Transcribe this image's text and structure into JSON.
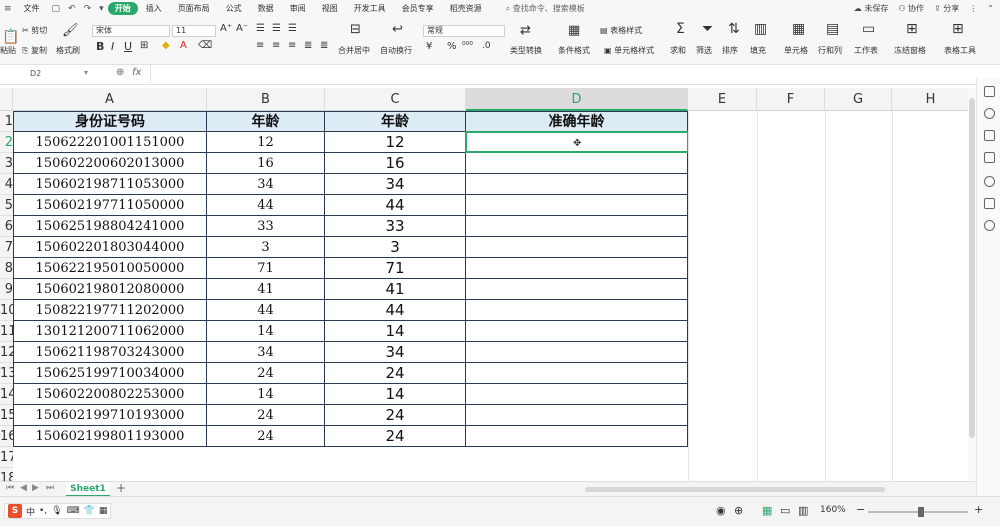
{
  "tabbar": {
    "file": "文件",
    "tabs": [
      "开始",
      "插入",
      "页面布局",
      "公式",
      "数据",
      "审阅",
      "视图",
      "开发工具",
      "会员专享",
      "稻壳资源"
    ],
    "active_tab": "开始",
    "search": "查找命令、搜索模板",
    "unsaved": "未保存",
    "collab": "协作",
    "share": "分享"
  },
  "ribbon": {
    "cut": "剪切",
    "paste": "粘贴",
    "copy": "复制",
    "format_painter": "格式刷",
    "font_name": "宋体",
    "font_size": "11",
    "bold": "B",
    "italic": "I",
    "underline": "U",
    "merge_center": "合并居中",
    "wrap_text": "自动换行",
    "number_format": "常规",
    "yen": "¥",
    "percent": "%",
    "type_convert": "类型转换",
    "cond_format": "条件格式",
    "table_style": "表格样式",
    "cell_style": "单元格样式",
    "sum": "求和",
    "filter": "筛选",
    "sort": "排序",
    "fill": "填充",
    "cell": "单元格",
    "rows_cols": "行和列",
    "worksheet": "工作表",
    "freeze": "冻结窗格",
    "table_tools": "表格工具"
  },
  "formula_bar": {
    "name_box": "D2",
    "fx": "fx"
  },
  "columns": [
    "A",
    "B",
    "C",
    "D",
    "E",
    "F",
    "G",
    "H"
  ],
  "selected_column": "D",
  "row_numbers": [
    "1",
    "2",
    "3",
    "4",
    "5",
    "6",
    "7",
    "8",
    "9",
    "10",
    "11",
    "12",
    "13",
    "14",
    "15",
    "16",
    "17",
    "18"
  ],
  "selected_row": "2",
  "table": {
    "headers": [
      "身份证号码",
      "年龄",
      "年龄",
      "准确年龄"
    ],
    "rows": [
      {
        "id": "150622201001151000",
        "age": "12",
        "age2": "12"
      },
      {
        "id": "150602200602013000",
        "age": "16",
        "age2": "16"
      },
      {
        "id": "150602198711053000",
        "age": "34",
        "age2": "34"
      },
      {
        "id": "150602197711050000",
        "age": "44",
        "age2": "44"
      },
      {
        "id": "150625198804241000",
        "age": "33",
        "age2": "33"
      },
      {
        "id": "150602201803044000",
        "age": "3",
        "age2": "3"
      },
      {
        "id": "150622195010050000",
        "age": "71",
        "age2": "71"
      },
      {
        "id": "150602198012080000",
        "age": "41",
        "age2": "41"
      },
      {
        "id": "150822197711202000",
        "age": "44",
        "age2": "44"
      },
      {
        "id": "130121200711062000",
        "age": "14",
        "age2": "14"
      },
      {
        "id": "150621198703243000",
        "age": "34",
        "age2": "34"
      },
      {
        "id": "150625199710034000",
        "age": "24",
        "age2": "24"
      },
      {
        "id": "150602200802253000",
        "age": "14",
        "age2": "14"
      },
      {
        "id": "150602199710193000",
        "age": "24",
        "age2": "24"
      },
      {
        "id": "150602199801193000",
        "age": "24",
        "age2": "24"
      }
    ]
  },
  "sheet_tabs": [
    "Sheet1"
  ],
  "add_sheet": "+",
  "status": {
    "zoom": "160%",
    "ime_lang": "中"
  },
  "colors": {
    "accent": "#2aa86a",
    "header_fill": "#ddebf5",
    "border": "#2a3a55"
  }
}
